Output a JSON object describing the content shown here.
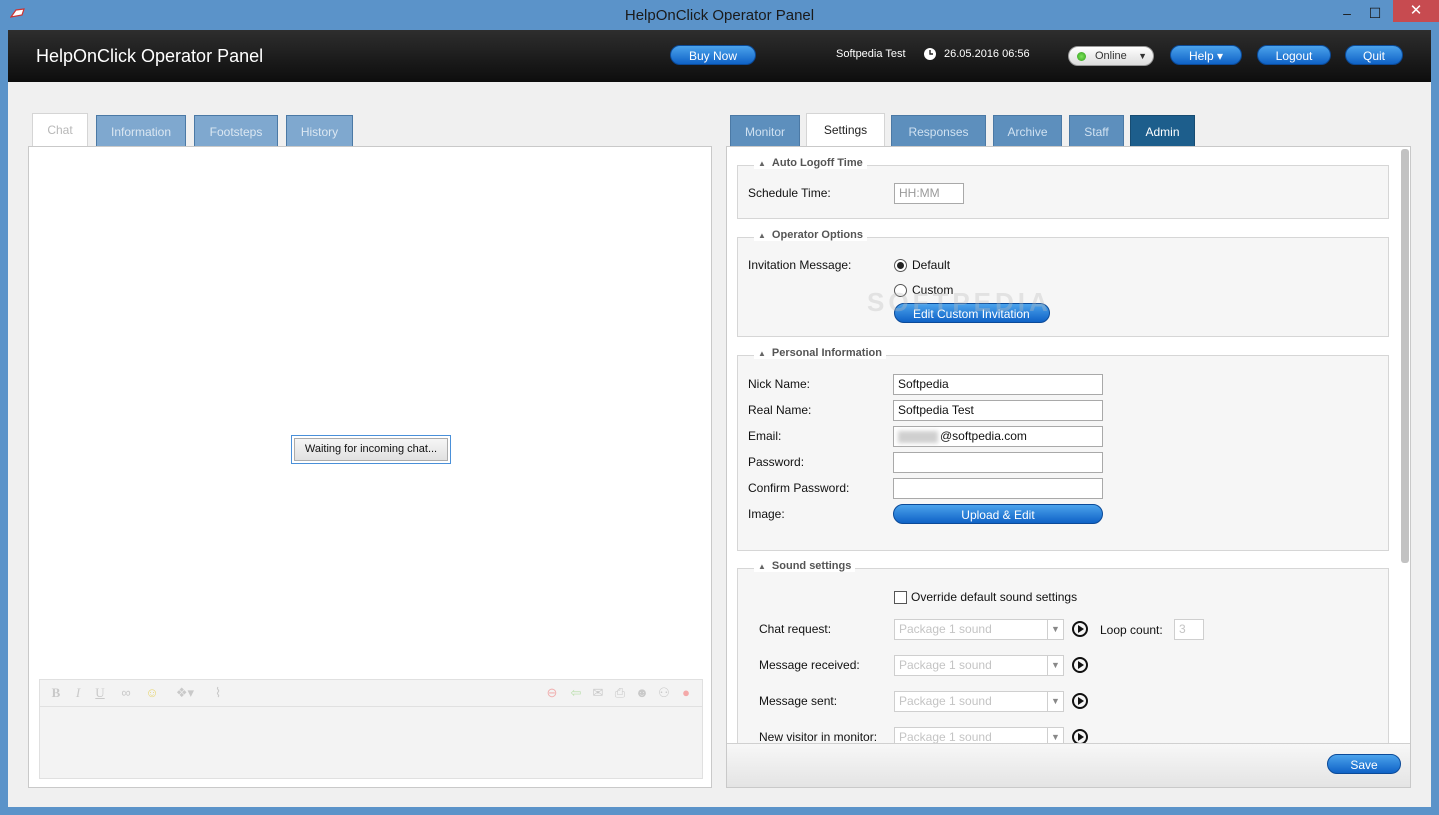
{
  "window": {
    "title": "HelpOnClick Operator Panel",
    "minimize": "–",
    "maximize": "☐",
    "close": "✕"
  },
  "header": {
    "app_title": "HelpOnClick Operator Panel",
    "buy_now": "Buy Now",
    "user": "Softpedia Test",
    "datetime": "26.05.2016 06:56",
    "status": "Online",
    "help": "Help ▾",
    "logout": "Logout",
    "quit": "Quit"
  },
  "left_tabs": [
    "Chat",
    "Information",
    "Footsteps",
    "History"
  ],
  "chat": {
    "waiting": "Waiting for incoming chat..."
  },
  "right_tabs": [
    "Monitor",
    "Settings",
    "Responses",
    "Archive",
    "Staff",
    "Admin"
  ],
  "settings": {
    "auto_logoff": {
      "legend": "Auto Logoff Time",
      "schedule_label": "Schedule Time:",
      "schedule_placeholder": "HH:MM"
    },
    "operator_options": {
      "legend": "Operator Options",
      "invitation_label": "Invitation Message:",
      "default_label": "Default",
      "custom_label": "Custom",
      "edit_invitation": "Edit Custom Invitation"
    },
    "personal": {
      "legend": "Personal Information",
      "nick_label": "Nick Name:",
      "nick_value": "Softpedia",
      "real_label": "Real Name:",
      "real_value": "Softpedia Test",
      "email_label": "Email:",
      "email_value": "@softpedia.com",
      "password_label": "Password:",
      "confirm_label": "Confirm Password:",
      "image_label": "Image:",
      "upload_button": "Upload & Edit"
    },
    "sound": {
      "legend": "Sound settings",
      "override_label": "Override default sound settings",
      "chat_request_label": "Chat request:",
      "message_received_label": "Message received:",
      "message_sent_label": "Message sent:",
      "new_visitor_label": "New visitor in monitor:",
      "sound_option": "Package 1 sound",
      "loop_label": "Loop count:",
      "loop_value": "3"
    },
    "save": "Save"
  },
  "watermark": "SOFTPEDIA"
}
